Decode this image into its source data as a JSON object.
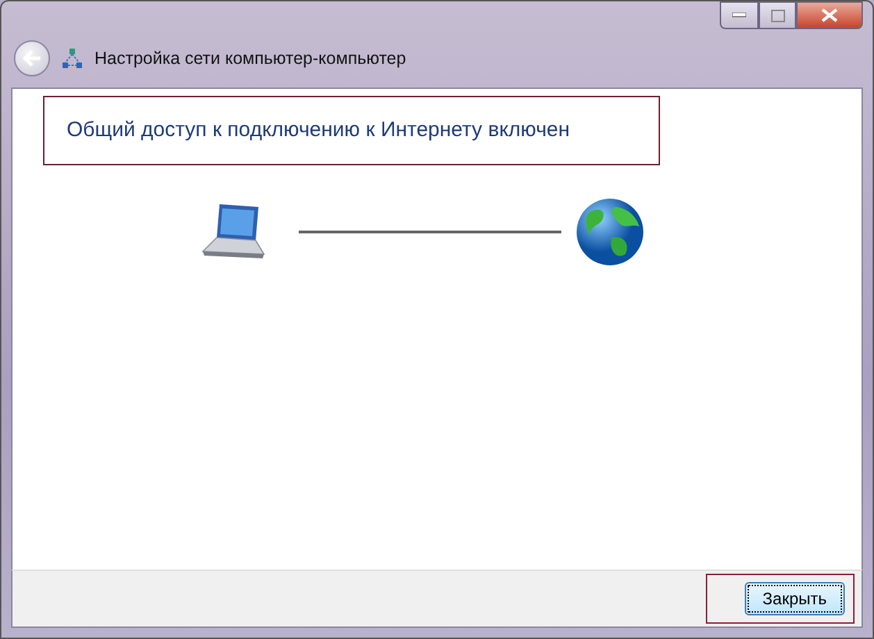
{
  "window": {
    "title": "Настройка сети компьютер-компьютер"
  },
  "heading": "Общий доступ к подключению к Интернету включен",
  "buttons": [
    {
      "label": "Закрыть",
      "default": true
    }
  ]
}
